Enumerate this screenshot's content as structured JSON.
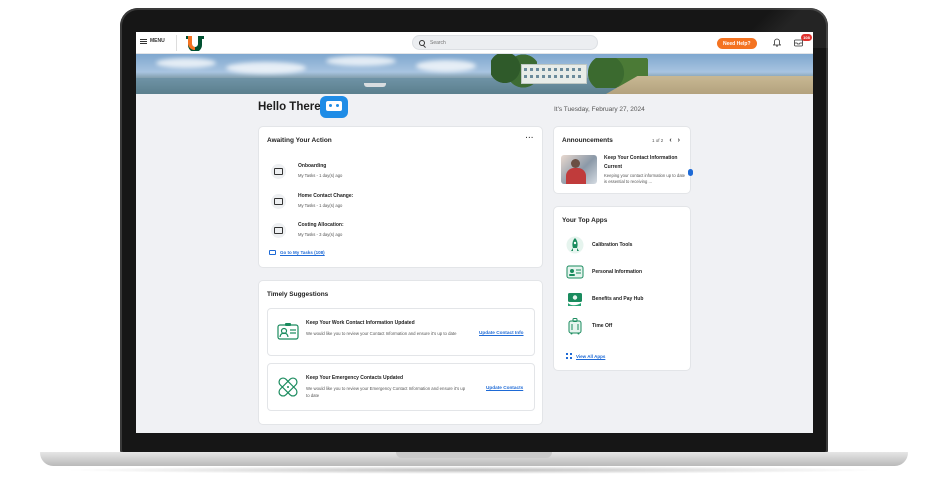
{
  "topbar": {
    "menu_label": "MENU",
    "search_placeholder": "Search",
    "help_label": "Need Help?",
    "inbox_badge": "108"
  },
  "greeting": {
    "title": "Hello There",
    "date": "It's Tuesday, February 27, 2024"
  },
  "awaiting": {
    "title": "Awaiting Your Action",
    "more": "···",
    "tasks": [
      {
        "title": "Onboarding",
        "subtitle": "My Tasks - 1 day(s) ago"
      },
      {
        "title": "Home Contact Change:",
        "subtitle": "My Tasks - 1 day(s) ago"
      },
      {
        "title": "Costing Allocation:",
        "subtitle": "My Tasks - 3 day(s) ago"
      }
    ],
    "goto_link": "Go to My Tasks (108)"
  },
  "timely": {
    "title": "Timely Suggestions",
    "items": [
      {
        "title": "Keep Your Work Contact Information Updated",
        "desc": "We would like you to review your Contact Information and ensure it's up to date",
        "link": "Update Contact Info",
        "icon": "contact-card-icon"
      },
      {
        "title": "Keep Your Emergency Contacts Updated",
        "desc": "We would like you to review your Emergency Contact Information and ensure it's up to date",
        "link": "Update Contacts",
        "icon": "bandage-icon"
      }
    ]
  },
  "announcements": {
    "title": "Announcements",
    "pager": "1 of 2",
    "prev": "‹",
    "next": "›",
    "item_title": "Keep Your Contact Information Current",
    "item_desc": "Keeping your contact information up to date is essential to receiving ..."
  },
  "topapps": {
    "title": "Your Top Apps",
    "apps": [
      {
        "label": "Calibration Tools",
        "icon": "rocket-icon"
      },
      {
        "label": "Personal Information",
        "icon": "id-card-icon"
      },
      {
        "label": "Benefits and Pay Hub",
        "icon": "money-icon"
      },
      {
        "label": "Time Off",
        "icon": "suitcase-icon"
      }
    ],
    "view_all": "View All Apps"
  },
  "colors": {
    "accent_orange": "#f47321",
    "link_blue": "#1e6ad6",
    "brand_green": "#005030",
    "app_green": "#1a8b5e"
  }
}
